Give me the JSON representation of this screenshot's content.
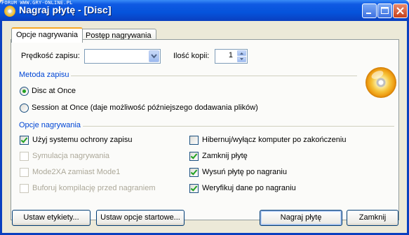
{
  "watermark": "FORUM WWW.GRY-ONLINE.PL",
  "window": {
    "title": "Nagraj płytę - [Disc]"
  },
  "tabs": [
    {
      "label": "Opcje nagrywania",
      "active": true
    },
    {
      "label": "Postęp nagrywania",
      "active": false
    }
  ],
  "speed": {
    "label": "Prędkość zapisu:",
    "value": ""
  },
  "copies": {
    "label": "Ilość kopii:",
    "value": "1"
  },
  "write_method": {
    "title": "Metoda zapisu",
    "options": [
      {
        "label": "Disc at Once",
        "selected": true
      },
      {
        "label": "Session at Once (daje możliwość późniejszego dodawania plików)",
        "selected": false
      }
    ]
  },
  "burn_options": {
    "title": "Opcje nagrywania",
    "left": [
      {
        "label": "Użyj systemu ochrony zapisu",
        "checked": true,
        "enabled": true
      },
      {
        "label": "Symulacja nagrywania",
        "checked": false,
        "enabled": false
      },
      {
        "label": "Mode2XA zamiast Mode1",
        "checked": false,
        "enabled": false
      },
      {
        "label": "Buforuj kompilację przed nagraniem",
        "checked": false,
        "enabled": false
      }
    ],
    "right": [
      {
        "label": "Hibernuj/wyłącz komputer po zakończeniu",
        "checked": false,
        "enabled": true
      },
      {
        "label": "Zamknij płytę",
        "checked": true,
        "enabled": true
      },
      {
        "label": "Wysuń płytę po nagraniu",
        "checked": true,
        "enabled": true
      },
      {
        "label": "Weryfikuj dane po nagraniu",
        "checked": true,
        "enabled": true
      }
    ]
  },
  "buttons": {
    "labels": "Ustaw etykiety...",
    "startup": "Ustaw opcje startowe...",
    "burn": "Nagraj płytę",
    "close": "Zamknij"
  }
}
